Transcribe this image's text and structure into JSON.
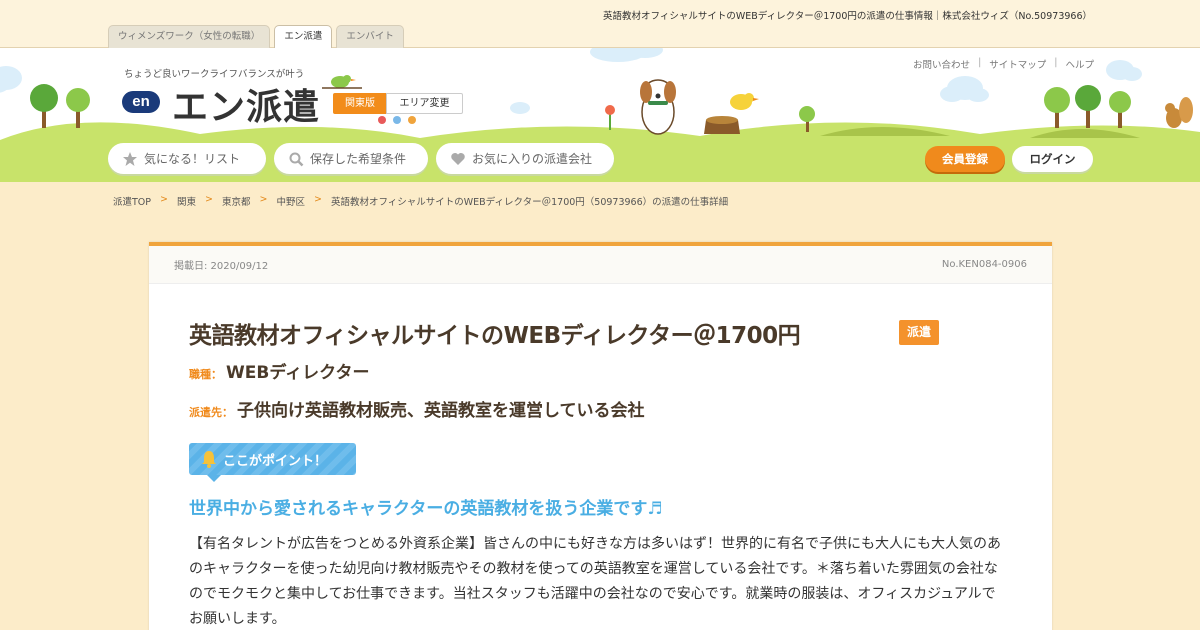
{
  "top": {
    "headline": "英語教材オフィシャルサイトのWEBディレクター＠1700円の派遣の仕事情報｜株式会社ウィズ（No.50973966）",
    "site_tabs": [
      "ウィメンズワーク（女性の転職）",
      "エン派遣",
      "エンバイト"
    ]
  },
  "header": {
    "tagline": "ちょうど良いワークライフバランスが叶う",
    "logo_mark": "en",
    "logo_text": "エン派遣",
    "region": "関東版",
    "area_change": "エリア変更",
    "util_links": [
      "お問い合わせ",
      "サイトマップ",
      "ヘルプ"
    ],
    "nav": {
      "watchlist": "気になる！リスト",
      "saved": "保存した希望条件",
      "favorites": "お気に入りの派遣会社"
    },
    "register": "会員登録",
    "login": "ログイン"
  },
  "breadcrumb": [
    "派遣TOP",
    "関東",
    "東京都",
    "中野区",
    "英語教材オフィシャルサイトのWEBディレクター＠1700円（50973966）の派遣の仕事詳細"
  ],
  "job": {
    "posted": "掲載日: 2020/09/12",
    "number": "No.KEN084-0906",
    "title": "英語教材オフィシャルサイトのWEBディレクター＠1700円",
    "type_badge": "派遣",
    "occupation_label": "職種：",
    "occupation": "WEBディレクター",
    "client_label": "派遣先：",
    "client": "子供向け英語教材販売、英語教室を運営している会社",
    "point_label": "ここがポイント！",
    "catch": "世界中から愛されるキャラクターの英語教材を扱う企業です♬",
    "description": "【有名タレントが広告をつとめる外資系企業】皆さんの中にも好きな方は多いはず！世界的に有名で子供にも大人にも大人気のあのキャラクターを使った幼児向け教材販売やその教材を使っての英語教室を運営している会社です。＊落ち着いた雰囲気の会社なのでモクモクと集中してお仕事できます。当社スタッフも活躍中の会社なので安心です。就業時の服装は、オフィスカジュアルでお願いします。"
  },
  "colors": {
    "accent": "#f08a1c",
    "point_blue": "#4aaee3",
    "grass": "#c8e36a",
    "background": "#fcecc9"
  }
}
